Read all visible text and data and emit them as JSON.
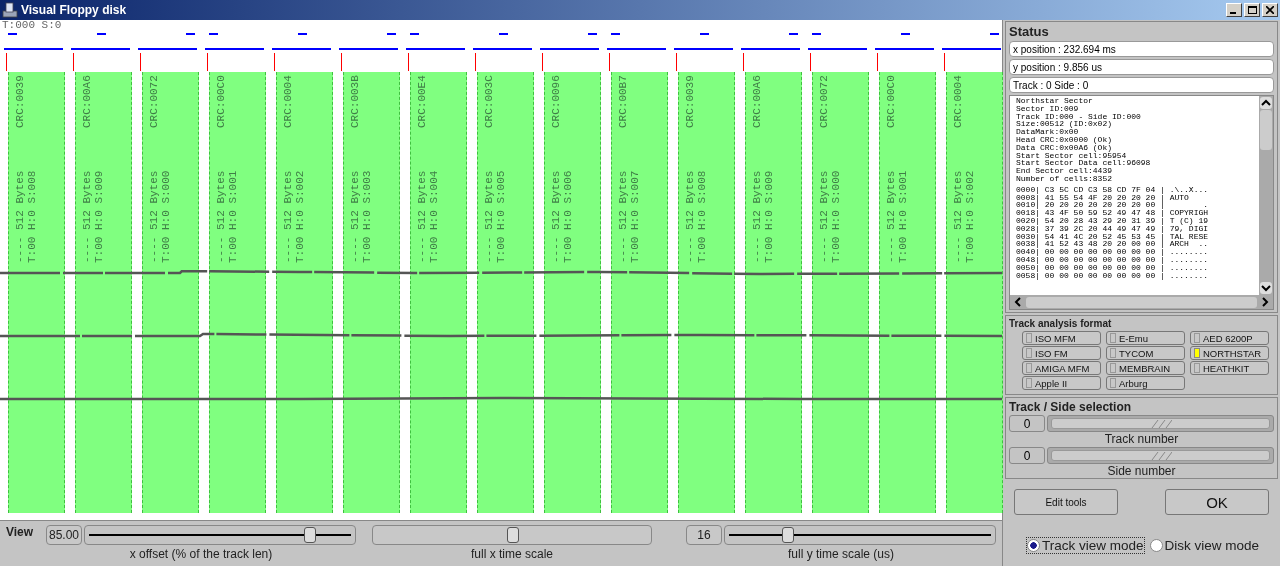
{
  "window": {
    "title": "Visual Floppy disk"
  },
  "track_view": {
    "header": "T:000 S:0",
    "sectors": [
      {
        "size": "---- 512 Bytes",
        "crc": "CRC:0039",
        "id": "T:00 H:0 S:008"
      },
      {
        "size": "---- 512 Bytes",
        "crc": "CRC:00A6",
        "id": "T:00 H:0 S:009"
      },
      {
        "size": "---- 512 Bytes",
        "crc": "CRC:0072",
        "id": "T:00 H:0 S:000"
      },
      {
        "size": "---- 512 Bytes",
        "crc": "CRC:00C0",
        "id": "T:00 H:0 S:001"
      },
      {
        "size": "---- 512 Bytes",
        "crc": "CRC:0004",
        "id": "T:00 H:0 S:002"
      },
      {
        "size": "---- 512 Bytes",
        "crc": "CRC:003B",
        "id": "T:00 H:0 S:003"
      },
      {
        "size": "---- 512 Bytes",
        "crc": "CRC:00E4",
        "id": "T:00 H:0 S:004"
      },
      {
        "size": "---- 512 Bytes",
        "crc": "CRC:003C",
        "id": "T:00 H:0 S:005"
      },
      {
        "size": "---- 512 Bytes",
        "crc": "CRC:0096",
        "id": "T:00 H:0 S:006"
      },
      {
        "size": "---- 512 Bytes",
        "crc": "CRC:00B7",
        "id": "T:00 H:0 S:007"
      },
      {
        "size": "---- 512 Bytes",
        "crc": "CRC:0039",
        "id": "T:00 H:0 S:008"
      },
      {
        "size": "---- 512 Bytes",
        "crc": "CRC:00A6",
        "id": "T:00 H:0 S:009"
      },
      {
        "size": "---- 512 Bytes",
        "crc": "CRC:0072",
        "id": "T:00 H:0 S:000"
      },
      {
        "size": "---- 512 Bytes",
        "crc": "CRC:00C0",
        "id": "T:00 H:0 S:001"
      },
      {
        "size": "---- 512 Bytes",
        "crc": "CRC:0004",
        "id": "T:00 H:0 S:002"
      }
    ]
  },
  "status": {
    "title": "Status",
    "fields": [
      "x position : 232.694 ms",
      "y position : 9.856 us",
      "Track : 0 Side : 0"
    ],
    "info_lines": [
      "Northstar Sector",
      "Sector ID:009",
      "Track ID:000 - Side ID:000",
      "Size:00512 (ID:0x02)",
      "DataMark:0x00",
      "Head CRC:0x0000 (Ok)",
      "Data CRC:0x00A6 (Ok)",
      "Start Sector cell:95954",
      "Start Sector Data cell:96098",
      "End Sector cell:4439",
      "Number of cells:8352"
    ],
    "hex_rows": [
      "0000| C3 5C CD C3 58 CD 7F 04 | .\\..X...",
      "0008| 41 55 54 4F 20 20 20 20 | AUTO",
      "0010| 20 20 20 20 20 20 20 00 |        .",
      "0018| 43 4F 50 59 52 49 47 48 | COPYRIGH",
      "0020| 54 20 28 43 29 20 31 39 | T (C) 19",
      "0028| 37 39 2C 20 44 49 47 49 | 79, DIGI",
      "0030| 54 41 4C 20 52 45 53 45 | TAL RESE",
      "0038| 41 52 43 48 20 20 00 00 | ARCH  ..",
      "0040| 00 00 00 00 00 00 00 00 | ........",
      "0048| 00 00 00 00 00 00 00 00 | ........",
      "0050| 00 00 00 00 00 00 00 00 | ........",
      "0058| 00 00 00 00 00 00 00 00 | ........"
    ]
  },
  "track_analysis": {
    "title": "Track analysis format",
    "formats": [
      {
        "label": "ISO MFM",
        "selected": false
      },
      {
        "label": "ISO FM",
        "selected": false
      },
      {
        "label": "AMIGA MFM",
        "selected": false
      },
      {
        "label": "Apple II",
        "selected": false
      },
      {
        "label": "E-Emu",
        "selected": false
      },
      {
        "label": "TYCOM",
        "selected": false
      },
      {
        "label": "MEMBRAIN",
        "selected": false
      },
      {
        "label": "Arburg",
        "selected": false
      },
      {
        "label": "AED 6200P",
        "selected": false
      },
      {
        "label": "NORTHSTAR",
        "selected": true
      },
      {
        "label": "HEATHKIT",
        "selected": false
      }
    ]
  },
  "track_side": {
    "title": "Track / Side selection",
    "selectors": [
      {
        "value": "0",
        "level": 1,
        "label": "Track number"
      },
      {
        "value": "0",
        "level": 1,
        "label": "Side number"
      }
    ]
  },
  "buttons": [
    {
      "label": "Edit tools",
      "kind": "small"
    },
    {
      "label": "OK",
      "kind": "large"
    }
  ],
  "view_modes": [
    {
      "label": "Track view mode",
      "selected": true
    },
    {
      "label": "Disk view mode",
      "selected": false
    }
  ],
  "view_bar": {
    "title": "View",
    "x_offset": {
      "value": "85.00",
      "level": 0.83,
      "label": "x offset (% of the track len)"
    },
    "x_time_scale": {
      "level": 0.5,
      "label": "full x time scale"
    },
    "y_time_scale": {
      "value": "16",
      "level": 0.23,
      "label": "full y time scale (us)"
    }
  }
}
